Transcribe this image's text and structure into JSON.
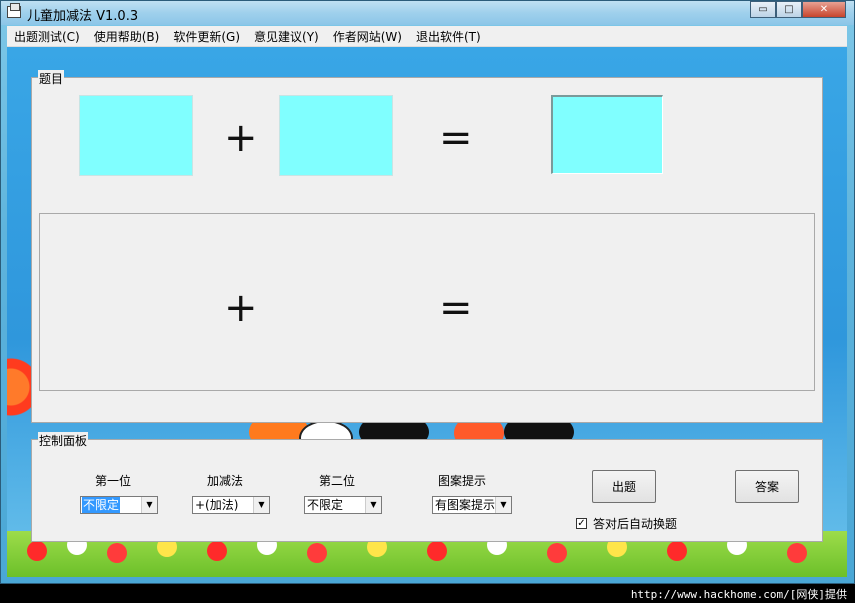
{
  "window": {
    "title": "儿童加减法 V1.0.3",
    "controls": {
      "minimize": "▭",
      "maximize": "□",
      "close": "✕"
    }
  },
  "menu": [
    "出题测试(C)",
    "使用帮助(B)",
    "软件更新(G)",
    "意见建议(Y)",
    "作者网站(W)",
    "退出软件(T)"
  ],
  "question_panel": {
    "label": "题目",
    "plus": "+",
    "equals": "=",
    "hint_plus": "+",
    "hint_equals": "="
  },
  "control_panel": {
    "label": "控制面板",
    "first_digit": {
      "label": "第一位",
      "value": "不限定"
    },
    "operation": {
      "label": "加减法",
      "value": "+(加法)"
    },
    "second_digit": {
      "label": "第二位",
      "value": "不限定"
    },
    "picture_hint": {
      "label": "图案提示",
      "value": "有图案提示"
    },
    "generate_button": "出题",
    "answer_button": "答案",
    "auto_next": {
      "label": "答对后自动换题",
      "checked": true,
      "mark": "✓"
    }
  },
  "watermark": "http://www.hackhome.com/[网侠]提供",
  "colors": {
    "answer_box": "#80ffff",
    "background_sky": "#39a6e6",
    "panel": "#f0f0f0"
  }
}
